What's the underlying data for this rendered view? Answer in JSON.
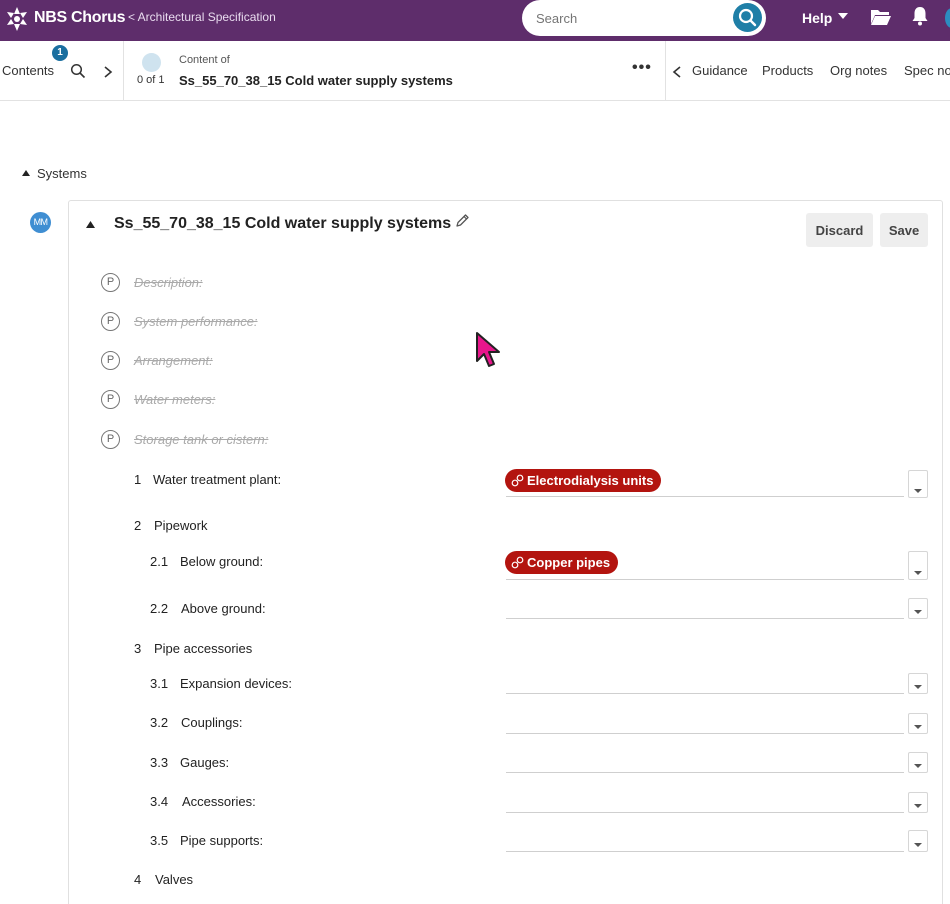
{
  "topbar": {
    "brand": "NBS Chorus",
    "breadcrumb": "< Architectural Specification",
    "search_placeholder": "Search",
    "help_label": "Help",
    "icons": [
      "nbs-logo-icon",
      "search-icon",
      "chevron-down-icon",
      "folder-icon",
      "bell-icon"
    ],
    "bar_color": "#5e2d6b"
  },
  "toolbar": {
    "contents_label": "Contents",
    "contents_badge": "1",
    "position": "0 of 1",
    "content_of_label": "Content of",
    "content_title": "Ss_55_70_38_15 Cold water supply systems",
    "more_label": "•••",
    "tabs": [
      "Guidance",
      "Products",
      "Org notes",
      "Spec no"
    ]
  },
  "section": {
    "label": "Systems",
    "author_initials": "MM"
  },
  "clause": {
    "code": "Ss_55_70_38_15",
    "name": "Cold water supply systems",
    "discard_label": "Discard",
    "save_label": "Save",
    "removed_properties": [
      {
        "icon": "P",
        "label": "Description:"
      },
      {
        "icon": "P",
        "label": "System performance:"
      },
      {
        "icon": "P",
        "label": "Arrangement:"
      },
      {
        "icon": "P",
        "label": "Water meters:"
      },
      {
        "icon": "P",
        "label": "Storage tank or cistern:"
      }
    ],
    "items": [
      {
        "num": "1",
        "label": "Water treatment plant:",
        "value": "Electrodialysis units"
      },
      {
        "num": "2",
        "label": "Pipework"
      },
      {
        "num": "2.1",
        "label": "Below ground:",
        "value": "Copper pipes"
      },
      {
        "num": "2.2",
        "label": "Above ground:",
        "value": ""
      },
      {
        "num": "3",
        "label": "Pipe accessories"
      },
      {
        "num": "3.1",
        "label": "Expansion devices:",
        "value": ""
      },
      {
        "num": "3.2",
        "label": "Couplings:",
        "value": ""
      },
      {
        "num": "3.3",
        "label": "Gauges:",
        "value": ""
      },
      {
        "num": "3.4",
        "label": "Accessories:",
        "value": ""
      },
      {
        "num": "3.5",
        "label": "Pipe supports:",
        "value": ""
      },
      {
        "num": "4",
        "label": "Valves"
      }
    ],
    "tag_color": "#b3140f"
  }
}
